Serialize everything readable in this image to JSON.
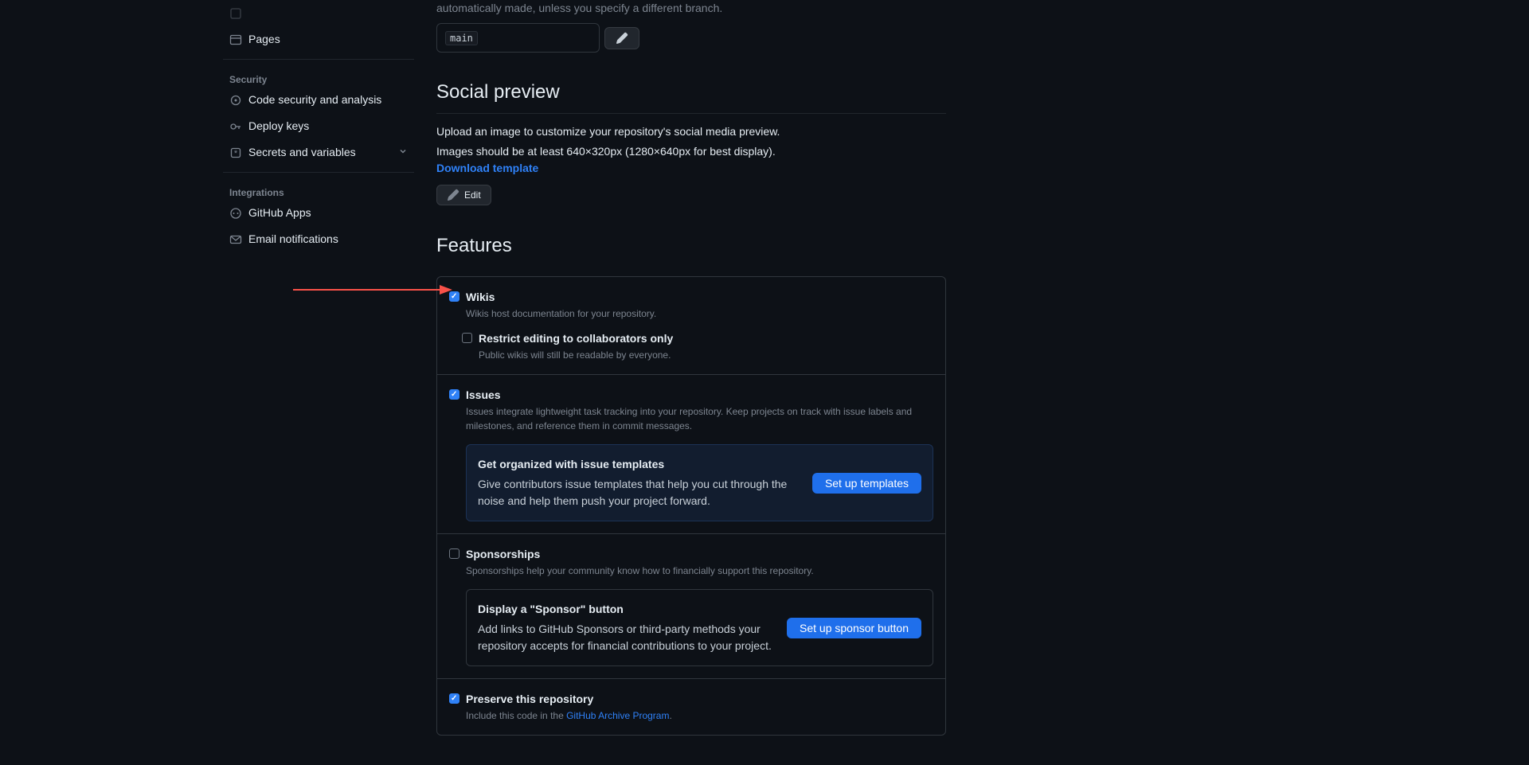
{
  "sidebar": {
    "top_item": "",
    "pages": "Pages",
    "security_heading": "Security",
    "code_security": "Code security and analysis",
    "deploy_keys": "Deploy keys",
    "secrets": "Secrets and variables",
    "integrations_heading": "Integrations",
    "github_apps": "GitHub Apps",
    "email_notifications": "Email notifications"
  },
  "default_branch": {
    "truncated_text": "automatically made, unless you specify a different branch.",
    "value": "main"
  },
  "social": {
    "heading": "Social preview",
    "desc": "Upload an image to customize your repository's social media preview.",
    "desc2": "Images should be at least 640×320px (1280×640px for best display).",
    "download": "Download template",
    "edit": "Edit"
  },
  "features": {
    "heading": "Features",
    "wikis": {
      "label": "Wikis",
      "desc": "Wikis host documentation for your repository.",
      "restrict_label": "Restrict editing to collaborators only",
      "restrict_desc": "Public wikis will still be readable by everyone."
    },
    "issues": {
      "label": "Issues",
      "desc": "Issues integrate lightweight task tracking into your repository. Keep projects on track with issue labels and milestones, and reference them in commit messages.",
      "prompt_title": "Get organized with issue templates",
      "prompt_desc": "Give contributors issue templates that help you cut through the noise and help them push your project forward.",
      "prompt_btn": "Set up templates"
    },
    "sponsorships": {
      "label": "Sponsorships",
      "desc": "Sponsorships help your community know how to financially support this repository.",
      "prompt_title": "Display a \"Sponsor\" button",
      "prompt_desc": "Add links to GitHub Sponsors or third-party methods your repository accepts for financial contributions to your project.",
      "prompt_btn": "Set up sponsor button"
    },
    "preserve": {
      "label": "Preserve this repository",
      "desc_prefix": "Include this code in the ",
      "desc_link": "GitHub Archive Program",
      "desc_suffix": "."
    }
  }
}
